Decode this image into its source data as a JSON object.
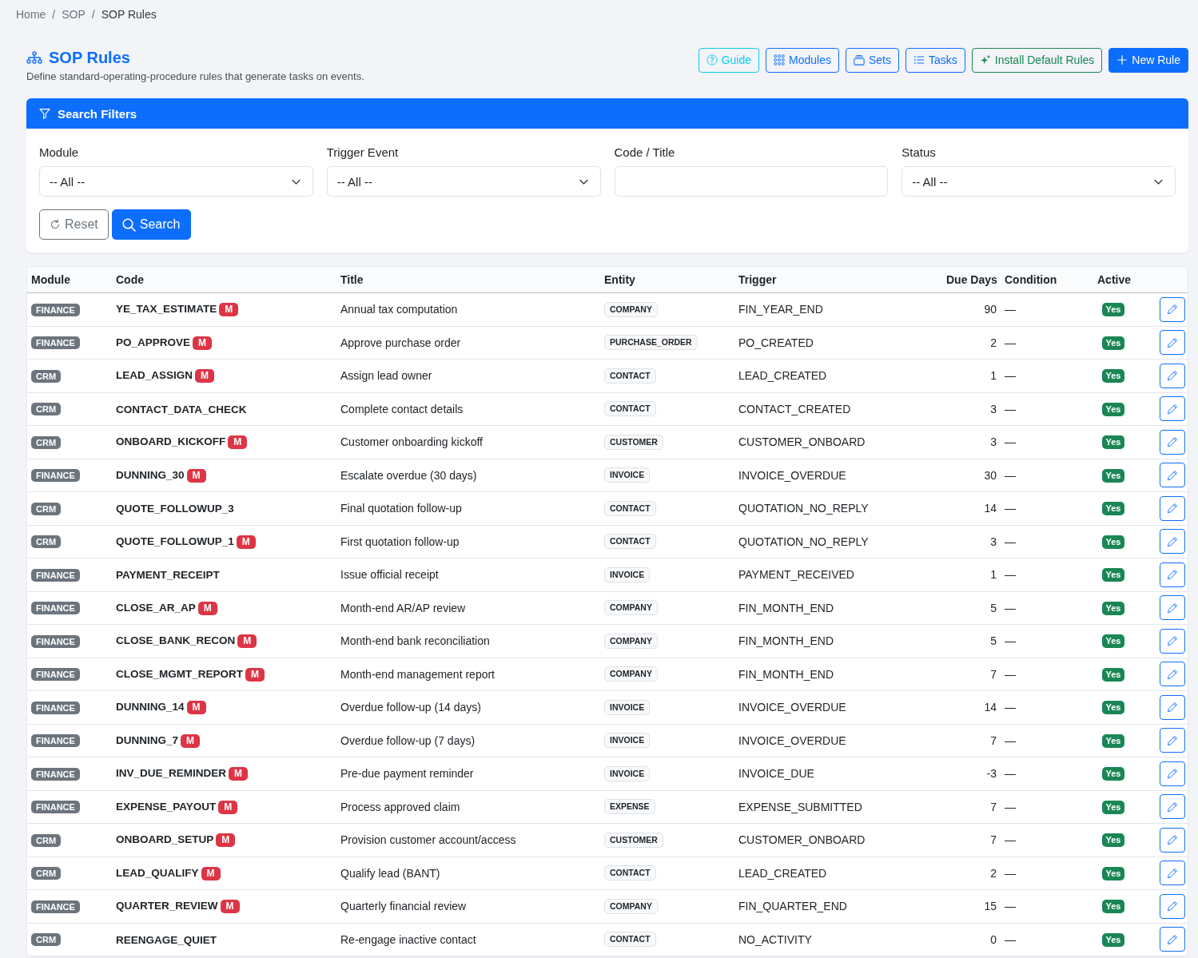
{
  "breadcrumb": [
    {
      "label": "Home",
      "kind": "link"
    },
    {
      "label": "/",
      "kind": "separator"
    },
    {
      "label": "SOP",
      "kind": "link"
    },
    {
      "label": "/",
      "kind": "separator"
    },
    {
      "label": "SOP Rules",
      "kind": "current"
    }
  ],
  "header": {
    "title": "SOP Rules",
    "subtitle": "Define standard-operating-procedure rules that generate tasks on events.",
    "buttons": [
      {
        "label": "Guide",
        "kind": "info"
      },
      {
        "label": "Modules",
        "kind": "outline"
      },
      {
        "label": "Sets",
        "kind": "outline"
      },
      {
        "label": "Tasks",
        "kind": "outline"
      },
      {
        "label": "Install Default Rules",
        "kind": "success"
      },
      {
        "label": "New Rule",
        "kind": "primary"
      }
    ]
  },
  "filters": {
    "title": "Search Filters",
    "fields": [
      {
        "label": "Module",
        "kind": "select",
        "value": "-- All --"
      },
      {
        "label": "Trigger Event",
        "kind": "select",
        "value": "-- All --"
      },
      {
        "label": "Code / Title",
        "kind": "text"
      },
      {
        "label": "Status",
        "kind": "select",
        "value": "-- All --"
      }
    ],
    "buttons": [
      {
        "label": "Reset",
        "kind": "secondary"
      },
      {
        "label": "Search",
        "kind": "primary"
      }
    ]
  },
  "table": {
    "columns": [
      "Module",
      "Code",
      "Title",
      "Entity",
      "Trigger",
      "Due Days",
      "Condition",
      "Active"
    ],
    "rows": [
      {
        "module": "FINANCE",
        "code": "YE_TAX_ESTIMATE",
        "flag": "M",
        "title": "Annual tax computation",
        "entity": "COMPANY",
        "trigger": "FIN_YEAR_END",
        "due_days": "90",
        "condition": "—",
        "active": "Yes"
      },
      {
        "module": "FINANCE",
        "code": "PO_APPROVE",
        "flag": "M",
        "title": "Approve purchase order",
        "entity": "PURCHASE_ORDER",
        "trigger": "PO_CREATED",
        "due_days": "2",
        "condition": "—",
        "active": "Yes"
      },
      {
        "module": "CRM",
        "code": "LEAD_ASSIGN",
        "flag": "M",
        "title": "Assign lead owner",
        "entity": "CONTACT",
        "trigger": "LEAD_CREATED",
        "due_days": "1",
        "condition": "—",
        "active": "Yes"
      },
      {
        "module": "CRM",
        "code": "CONTACT_DATA_CHECK",
        "title": "Complete contact details",
        "entity": "CONTACT",
        "trigger": "CONTACT_CREATED",
        "due_days": "3",
        "condition": "—",
        "active": "Yes"
      },
      {
        "module": "CRM",
        "code": "ONBOARD_KICKOFF",
        "flag": "M",
        "title": "Customer onboarding kickoff",
        "entity": "CUSTOMER",
        "trigger": "CUSTOMER_ONBOARD",
        "due_days": "3",
        "condition": "—",
        "active": "Yes"
      },
      {
        "module": "FINANCE",
        "code": "DUNNING_30",
        "flag": "M",
        "title": "Escalate overdue (30 days)",
        "entity": "INVOICE",
        "trigger": "INVOICE_OVERDUE",
        "due_days": "30",
        "condition": "—",
        "active": "Yes"
      },
      {
        "module": "CRM",
        "code": "QUOTE_FOLLOWUP_3",
        "title": "Final quotation follow-up",
        "entity": "CONTACT",
        "trigger": "QUOTATION_NO_REPLY",
        "due_days": "14",
        "condition": "—",
        "active": "Yes"
      },
      {
        "module": "CRM",
        "code": "QUOTE_FOLLOWUP_1",
        "flag": "M",
        "title": "First quotation follow-up",
        "entity": "CONTACT",
        "trigger": "QUOTATION_NO_REPLY",
        "due_days": "3",
        "condition": "—",
        "active": "Yes"
      },
      {
        "module": "FINANCE",
        "code": "PAYMENT_RECEIPT",
        "title": "Issue official receipt",
        "entity": "INVOICE",
        "trigger": "PAYMENT_RECEIVED",
        "due_days": "1",
        "condition": "—",
        "active": "Yes"
      },
      {
        "module": "FINANCE",
        "code": "CLOSE_AR_AP",
        "flag": "M",
        "title": "Month-end AR/AP review",
        "entity": "COMPANY",
        "trigger": "FIN_MONTH_END",
        "due_days": "5",
        "condition": "—",
        "active": "Yes"
      },
      {
        "module": "FINANCE",
        "code": "CLOSE_BANK_RECON",
        "flag": "M",
        "title": "Month-end bank reconciliation",
        "entity": "COMPANY",
        "trigger": "FIN_MONTH_END",
        "due_days": "5",
        "condition": "—",
        "active": "Yes"
      },
      {
        "module": "FINANCE",
        "code": "CLOSE_MGMT_REPORT",
        "flag": "M",
        "title": "Month-end management report",
        "entity": "COMPANY",
        "trigger": "FIN_MONTH_END",
        "due_days": "7",
        "condition": "—",
        "active": "Yes"
      },
      {
        "module": "FINANCE",
        "code": "DUNNING_14",
        "flag": "M",
        "title": "Overdue follow-up (14 days)",
        "entity": "INVOICE",
        "trigger": "INVOICE_OVERDUE",
        "due_days": "14",
        "condition": "—",
        "active": "Yes"
      },
      {
        "module": "FINANCE",
        "code": "DUNNING_7",
        "flag": "M",
        "title": "Overdue follow-up (7 days)",
        "entity": "INVOICE",
        "trigger": "INVOICE_OVERDUE",
        "due_days": "7",
        "condition": "—",
        "active": "Yes"
      },
      {
        "module": "FINANCE",
        "code": "INV_DUE_REMINDER",
        "flag": "M",
        "title": "Pre-due payment reminder",
        "entity": "INVOICE",
        "trigger": "INVOICE_DUE",
        "due_days": "-3",
        "condition": "—",
        "active": "Yes"
      },
      {
        "module": "FINANCE",
        "code": "EXPENSE_PAYOUT",
        "flag": "M",
        "title": "Process approved claim",
        "entity": "EXPENSE",
        "trigger": "EXPENSE_SUBMITTED",
        "due_days": "7",
        "condition": "—",
        "active": "Yes"
      },
      {
        "module": "CRM",
        "code": "ONBOARD_SETUP",
        "flag": "M",
        "title": "Provision customer account/access",
        "entity": "CUSTOMER",
        "trigger": "CUSTOMER_ONBOARD",
        "due_days": "7",
        "condition": "—",
        "active": "Yes"
      },
      {
        "module": "CRM",
        "code": "LEAD_QUALIFY",
        "flag": "M",
        "title": "Qualify lead (BANT)",
        "entity": "CONTACT",
        "trigger": "LEAD_CREATED",
        "due_days": "2",
        "condition": "—",
        "active": "Yes"
      },
      {
        "module": "FINANCE",
        "code": "QUARTER_REVIEW",
        "flag": "M",
        "title": "Quarterly financial review",
        "entity": "COMPANY",
        "trigger": "FIN_QUARTER_END",
        "due_days": "15",
        "condition": "—",
        "active": "Yes"
      },
      {
        "module": "CRM",
        "code": "REENGAGE_QUIET",
        "title": "Re-engage inactive contact",
        "entity": "CONTACT",
        "trigger": "NO_ACTIVITY",
        "due_days": "0",
        "condition": "—",
        "active": "Yes"
      }
    ]
  }
}
